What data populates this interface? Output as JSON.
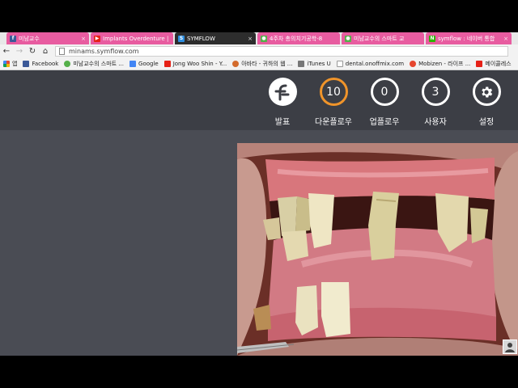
{
  "tabs": [
    {
      "label": "미남교수",
      "favicon": "facebook-icon",
      "color": "#3b5998"
    },
    {
      "label": "Implants Overdenture |",
      "favicon": "youtube-icon",
      "color": "#e62117"
    },
    {
      "label": "SYMFLOW",
      "favicon": "symflow-icon",
      "color": "#2d8ee0"
    },
    {
      "label": "4주차 총의치기공학-8",
      "favicon": "chrome-green-icon",
      "color": "#55b04a"
    },
    {
      "label": "미남교수의 스마트 교",
      "favicon": "chrome-green-icon",
      "color": "#55b04a"
    },
    {
      "label": "symflow : 네이버 통합",
      "favicon": "naver-icon",
      "color": "#2db400"
    }
  ],
  "url": "minams.symflow.com",
  "bookmarks": [
    {
      "label": "앱",
      "icon": "apps-grid-icon",
      "color": "#e04a3b"
    },
    {
      "label": "Facebook",
      "icon": "facebook-icon",
      "color": "#3b5998"
    },
    {
      "label": "미남교수의 스마트 ...",
      "icon": "chrome-green-icon",
      "color": "#55b04a"
    },
    {
      "label": "Google",
      "icon": "google-icon",
      "color": "#4285f4"
    },
    {
      "label": "Jong Woo Shin - Y...",
      "icon": "youtube-icon",
      "color": "#e62117"
    },
    {
      "label": "아바타 - 귀하의 웹 ...",
      "icon": "avatar-icon",
      "color": "#d36b2d"
    },
    {
      "label": "iTunes U",
      "icon": "itunes-icon",
      "color": "#777777"
    },
    {
      "label": "dental.onoffmix.com",
      "icon": "page-icon",
      "color": "#999999"
    },
    {
      "label": "Mobizen - 라이프 ...",
      "icon": "mobizen-icon",
      "color": "#e6462e"
    },
    {
      "label": "메이콜레스",
      "icon": "youtube-icon",
      "color": "#e62117"
    }
  ],
  "nav": {
    "present": {
      "label": "발표"
    },
    "download": {
      "label": "다운플로우",
      "count": "10"
    },
    "upload": {
      "label": "업플로우",
      "count": "0"
    },
    "users": {
      "label": "사용자",
      "count": "3"
    },
    "settings": {
      "label": "설정"
    }
  },
  "colors": {
    "header": "#3c3e45",
    "page": "#4a4c54",
    "accent": "#f0942a"
  }
}
